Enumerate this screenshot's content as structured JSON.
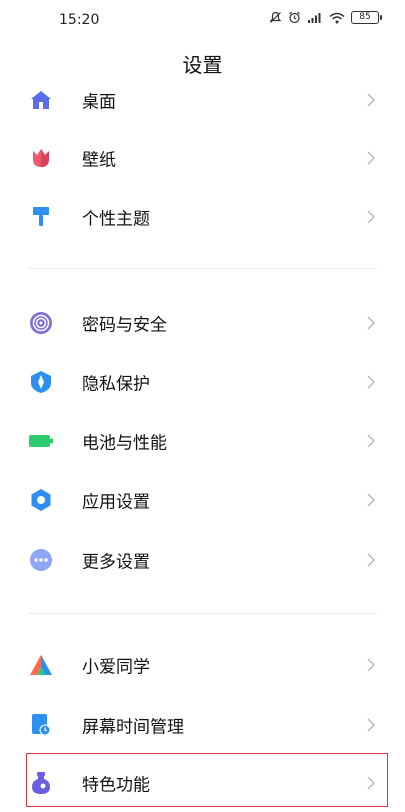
{
  "status_bar": {
    "time": "15:20",
    "battery": "85",
    "icons": [
      "mute-bell-icon",
      "alarm-icon",
      "signal-icon",
      "wifi-icon",
      "battery-icon"
    ]
  },
  "header": {
    "title": "设置"
  },
  "groups": [
    {
      "items": [
        {
          "label": "桌面",
          "icon": "home-icon",
          "color": "#5b6ee8"
        },
        {
          "label": "壁纸",
          "icon": "tulip-icon",
          "color": "#f05a6e"
        },
        {
          "label": "个性主题",
          "icon": "paint-roller-icon",
          "color": "#2d8ff0"
        }
      ]
    },
    {
      "items": [
        {
          "label": "密码与安全",
          "icon": "fingerprint-icon",
          "color": "#7b6fe0"
        },
        {
          "label": "隐私保护",
          "icon": "shield-icon",
          "color": "#2d8ff0"
        },
        {
          "label": "电池与性能",
          "icon": "battery-icon",
          "color": "#2ecc71"
        },
        {
          "label": "应用设置",
          "icon": "gear-icon",
          "color": "#2d8ff0"
        },
        {
          "label": "更多设置",
          "icon": "more-dots-icon",
          "color": "#8fa6f5"
        }
      ]
    },
    {
      "items": [
        {
          "label": "小爱同学",
          "icon": "xiaoai-icon",
          "color": "#ff6b4a"
        },
        {
          "label": "屏幕时间管理",
          "icon": "screen-time-icon",
          "color": "#2d8ff0"
        },
        {
          "label": "特色功能",
          "icon": "potion-icon",
          "color": "#6a5fe0"
        }
      ]
    }
  ]
}
